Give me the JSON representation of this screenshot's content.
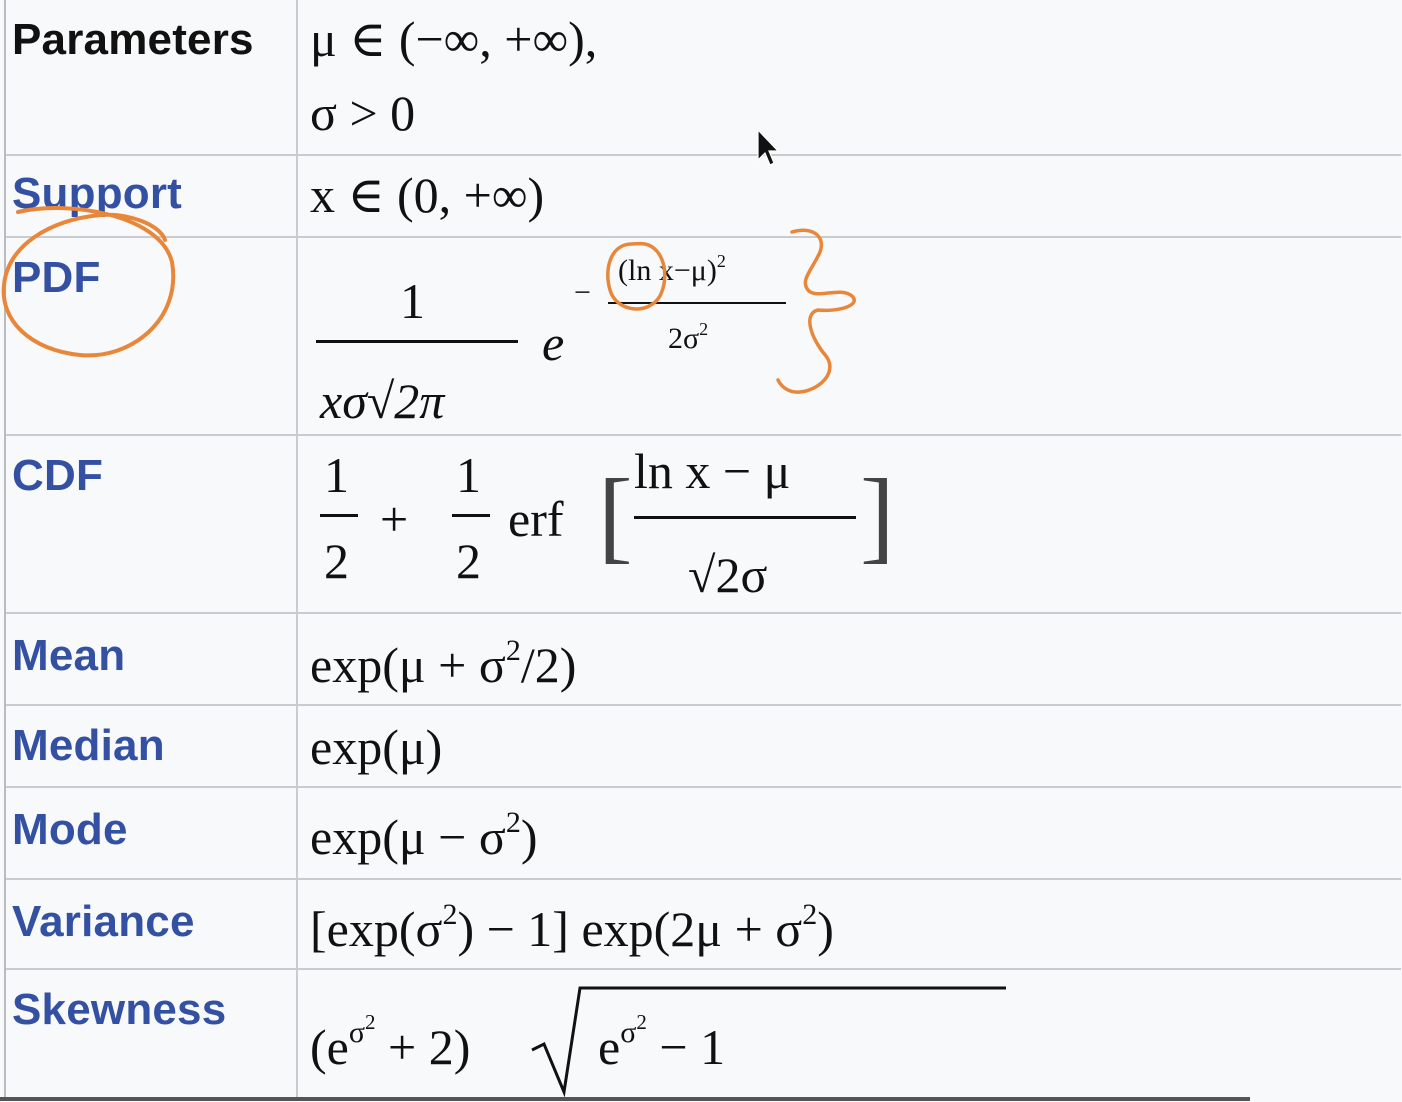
{
  "rows": {
    "parameters": {
      "label": "Parameters",
      "line1": "μ ∈ (−∞, +∞),",
      "line2": "σ > 0"
    },
    "support": {
      "label": "Support",
      "value": "x ∈ (0, +∞)"
    },
    "pdf": {
      "label": "PDF",
      "num": "1",
      "den": "xσ√2π",
      "base": "e",
      "minus": "−",
      "exp_num": "(ln x−μ)",
      "exp_num_sup": "2",
      "exp_den": "2σ",
      "exp_den_sup": "2"
    },
    "cdf": {
      "label": "CDF",
      "half1_num": "1",
      "half1_den": "2",
      "plus": "+",
      "half2_num": "1",
      "half2_den": "2",
      "erf": "erf",
      "lbracket": "[",
      "inner_num": "ln x − μ",
      "inner_den": "√2σ",
      "rbracket": "]"
    },
    "mean": {
      "label": "Mean",
      "value_a": "exp(μ + σ",
      "value_sup": "2",
      "value_b": "/2)"
    },
    "median": {
      "label": "Median",
      "value": "exp(μ)"
    },
    "mode": {
      "label": "Mode",
      "value_a": "exp(μ − σ",
      "value_sup": "2",
      "value_b": ")"
    },
    "variance": {
      "label": "Variance",
      "value_a": "[exp(σ",
      "sup1": "2",
      "value_b": ") − 1] exp(2μ + σ",
      "sup2": "2",
      "value_c": ")"
    },
    "skewness": {
      "label": "Skewness",
      "value_a": "(e",
      "sup_a": "σ",
      "sup_a2": "2",
      "value_b": " + 2)",
      "root_a": "e",
      "root_sup": "σ",
      "root_sup2": "2",
      "root_b": " − 1"
    }
  },
  "colors": {
    "label_link": "#3450a3",
    "label_plain": "#111111",
    "annotation": "#e8863a",
    "border": "#c8ccd0"
  },
  "cursor": "mouse-pointer"
}
